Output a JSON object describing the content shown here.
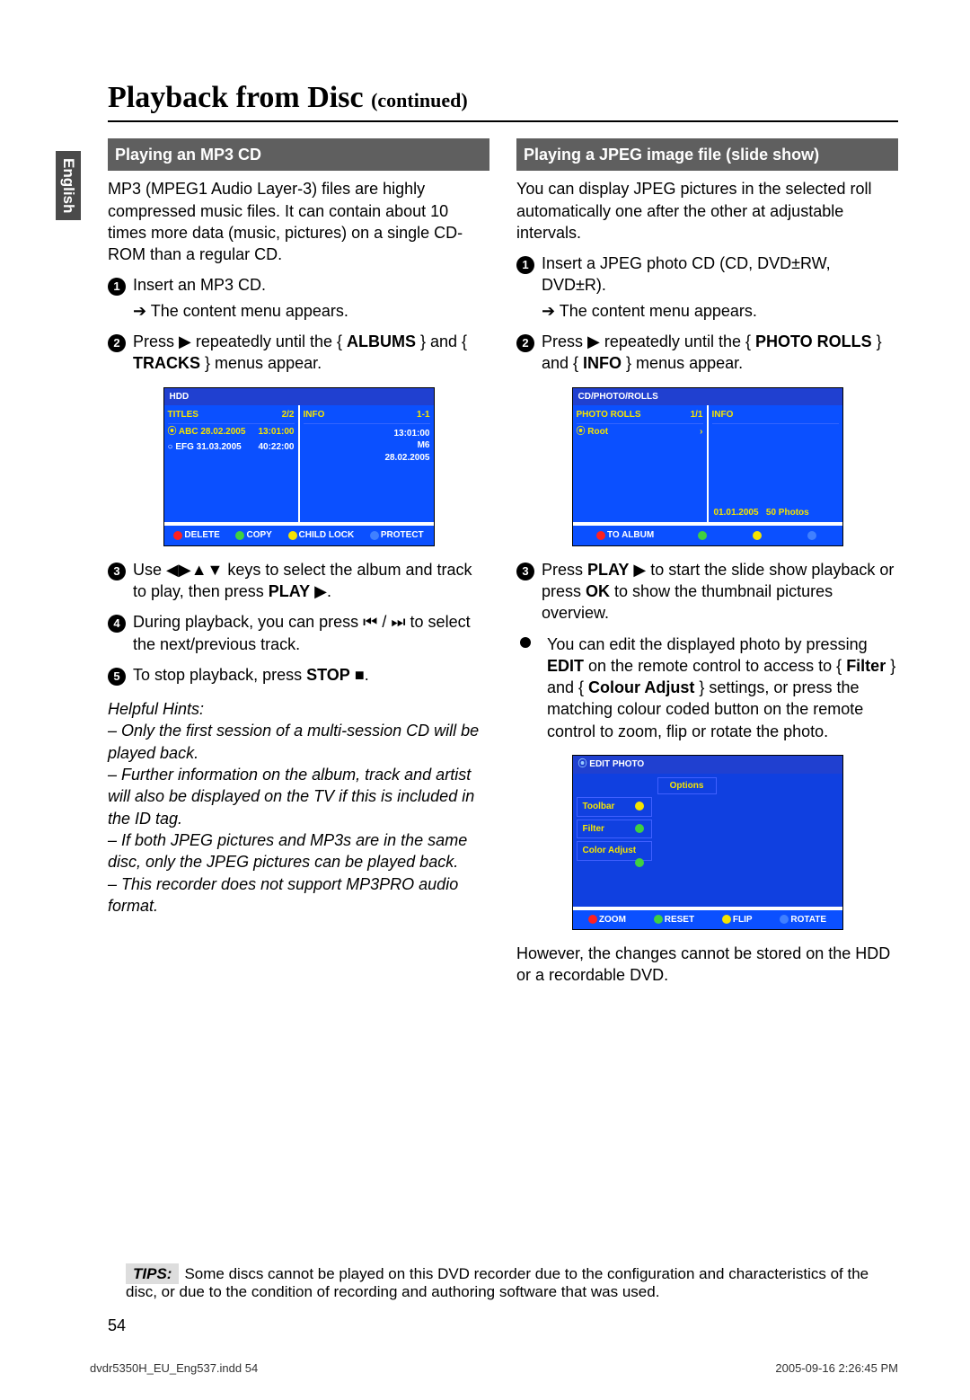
{
  "language_tab": "English",
  "title_main": "Playback from Disc",
  "title_cont": "(continued)",
  "left": {
    "header": "Playing an MP3 CD",
    "intro": "MP3 (MPEG1 Audio Layer-3) files are highly compressed music files. It can contain about 10 times more data (music, pictures) on a single CD-ROM than a regular CD.",
    "step1": "Insert an MP3 CD.",
    "step1_sub": "The content menu appears.",
    "step2_a": "Press ",
    "step2_b": " repeatedly until the { ",
    "step2_albums": "ALBUMS",
    "step2_c": " } and { ",
    "step2_tracks": "TRACKS",
    "step2_d": " } menus appear.",
    "osd1": {
      "top": "HDD",
      "left_header": "TITLES",
      "left_count": "2/2",
      "right_header": "INFO",
      "right_count": "1-1",
      "row1_a": "ABC 28.02.2005",
      "row1_b": "13:01:00",
      "row2_a": "EFG 31.03.2005",
      "row2_b": "40:22:00",
      "info_time": "13:01:00",
      "info_m6": "M6",
      "info_date": "28.02.2005",
      "btn_delete": "DELETE",
      "btn_copy": "COPY",
      "btn_childlock": "CHILD LOCK",
      "btn_protect": "PROTECT"
    },
    "step3_a": "Use ",
    "step3_b": " keys to select the album and track to play, then press ",
    "step3_play": "PLAY",
    "step3_c": ".",
    "step4_a": "During playback, you can press ",
    "step4_b": " to select the next/previous track.",
    "step5_a": "To stop playback, press ",
    "step5_stop": "STOP",
    "step5_b": ".",
    "hints_title": "Helpful Hints:",
    "hint1": "– Only the first session of a multi-session CD will be played back.",
    "hint2": "– Further information on the album, track and artist will also be displayed on the TV if this is included in the ID tag.",
    "hint3": "– If both JPEG pictures and MP3s are in the same disc, only the JPEG pictures can be played back.",
    "hint4": "– This recorder does not support MP3PRO audio format."
  },
  "right": {
    "header": "Playing a JPEG image file (slide show)",
    "intro": "You can display JPEG pictures in the selected roll automatically one after the other at adjustable intervals.",
    "step1": "Insert a JPEG photo CD (CD, DVD±RW, DVD±R).",
    "step1_sub": "The content menu appears.",
    "step2_a": "Press ",
    "step2_b": " repeatedly until the { ",
    "step2_photo": "PHOTO ROLLS",
    "step2_c": " } and { ",
    "step2_info": "INFO",
    "step2_d": " } menus appear.",
    "osd2": {
      "top": "CD/PHOTO/ROLLS",
      "left_header": "PHOTO ROLLS",
      "left_count": "1/1",
      "right_header": "INFO",
      "root": "Root",
      "info_date": "01.01.2005",
      "info_photos": "50 Photos",
      "btn_toalbum": "TO ALBUM"
    },
    "step3_a": "Press ",
    "step3_play": "PLAY",
    "step3_b": " to start the slide show playback or press ",
    "step3_ok": "OK",
    "step3_c": " to show the thumbnail pictures overview.",
    "bullet_a": "You can edit the displayed photo by pressing ",
    "bullet_edit": "EDIT",
    "bullet_b": " on the remote control to access to { ",
    "bullet_filter": "Filter",
    "bullet_c": " } and { ",
    "bullet_colour": "Colour Adjust",
    "bullet_d": " } settings, or press the matching colour coded button on the remote control to zoom, flip or rotate the photo.",
    "osd3": {
      "top": "EDIT PHOTO",
      "options": "Options",
      "m1": "Toolbar",
      "m2": "Filter",
      "m3": "Color Adjust",
      "btn_zoom": "ZOOM",
      "btn_reset": "RESET",
      "btn_flip": "FLIP",
      "btn_rotate": "ROTATE"
    },
    "closing": "However, the changes cannot be stored on the HDD or a recordable DVD."
  },
  "tips_label": "TIPS:",
  "tips_text": "Some discs cannot be played on this DVD recorder due to the configuration and characteristics of the disc, or due to the condition of recording and authoring software that was used.",
  "page_number": "54",
  "footer_left": "dvdr5350H_EU_Eng537.indd   54",
  "footer_right": "2005-09-16   2:26:45 PM"
}
